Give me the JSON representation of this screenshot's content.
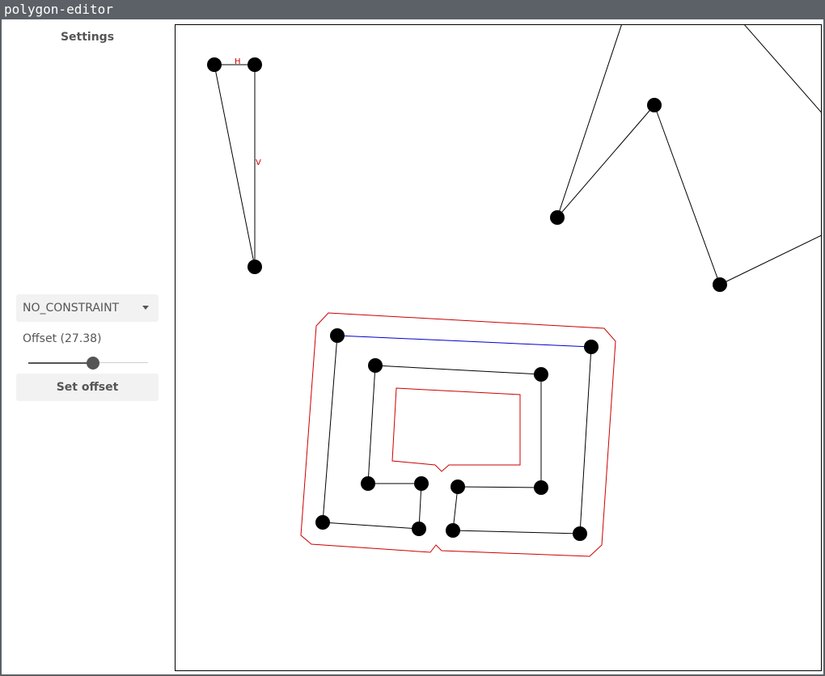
{
  "app": {
    "title": "polygon-editor"
  },
  "sidebar": {
    "title": "Settings",
    "constraint_select": {
      "selected": "NO_CONSTRAINT"
    },
    "offset": {
      "label": "Offset (27.38)",
      "value": 27.38,
      "slider_fraction": 0.54
    },
    "set_offset_label": "Set offset"
  },
  "canvas": {
    "edge_labels": [
      "H",
      "V"
    ],
    "colors": {
      "vertex": "#000000",
      "edge": "#000000",
      "selected_edge": "#0000cc",
      "offset": "#cc0000",
      "constraint_label": "#cc0000"
    }
  }
}
